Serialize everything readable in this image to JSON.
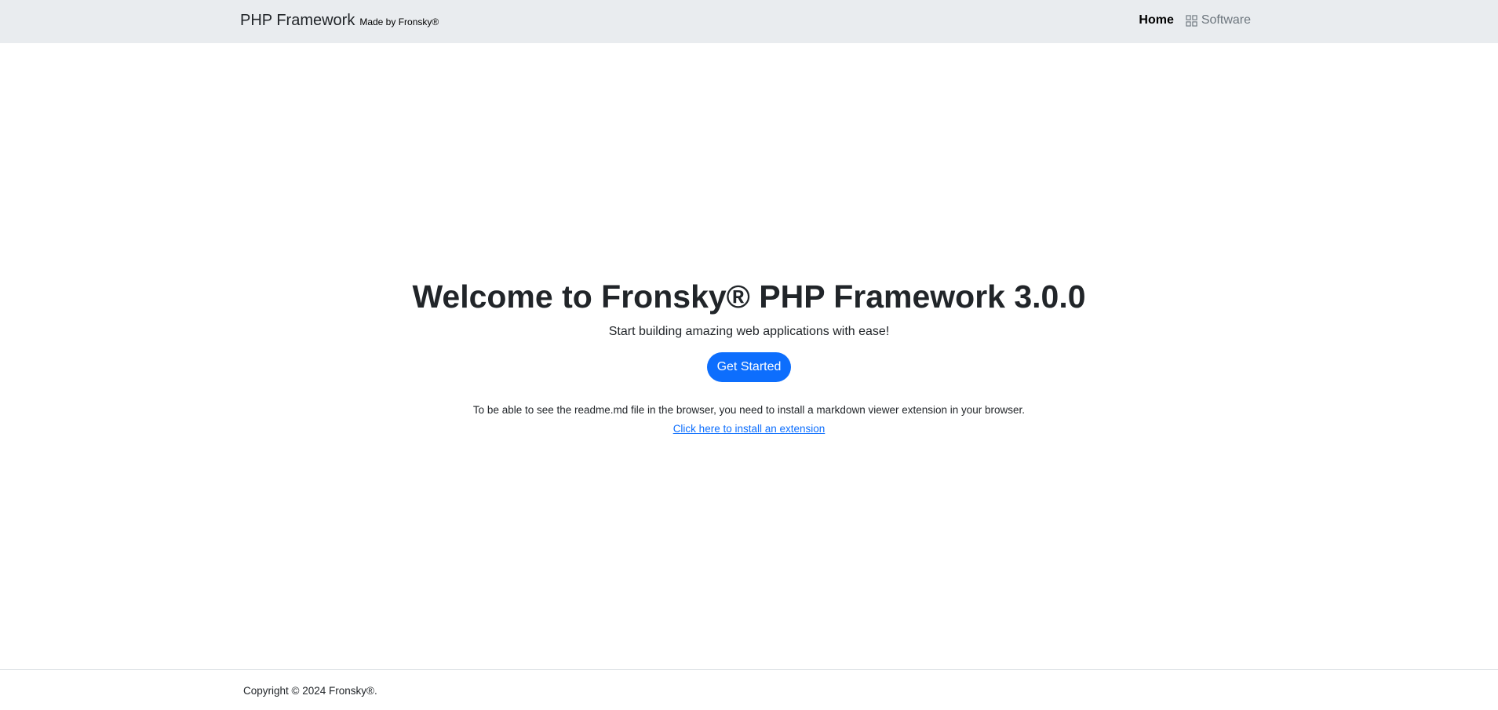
{
  "navbar": {
    "brand": "PHP Framework",
    "brand_sub": "Made by Fronsky®",
    "links": [
      {
        "label": "Home",
        "active": true
      },
      {
        "label": "Software",
        "icon": "grid-icon",
        "active": false
      }
    ]
  },
  "hero": {
    "title": "Welcome to Fronsky® PHP Framework 3.0.0",
    "subtitle": "Start building amazing web applications with ease!",
    "cta_label": "Get Started",
    "note": "To be able to see the readme.md file in the browser, you need to install a markdown viewer extension in your browser.",
    "link_label": "Click here to install an extension"
  },
  "footer": {
    "copyright": "Copyright © 2024 Fronsky®."
  },
  "colors": {
    "navbar_bg": "#e9ecef",
    "primary": "#0d6efd",
    "text": "#212529",
    "muted": "#6c757d"
  }
}
